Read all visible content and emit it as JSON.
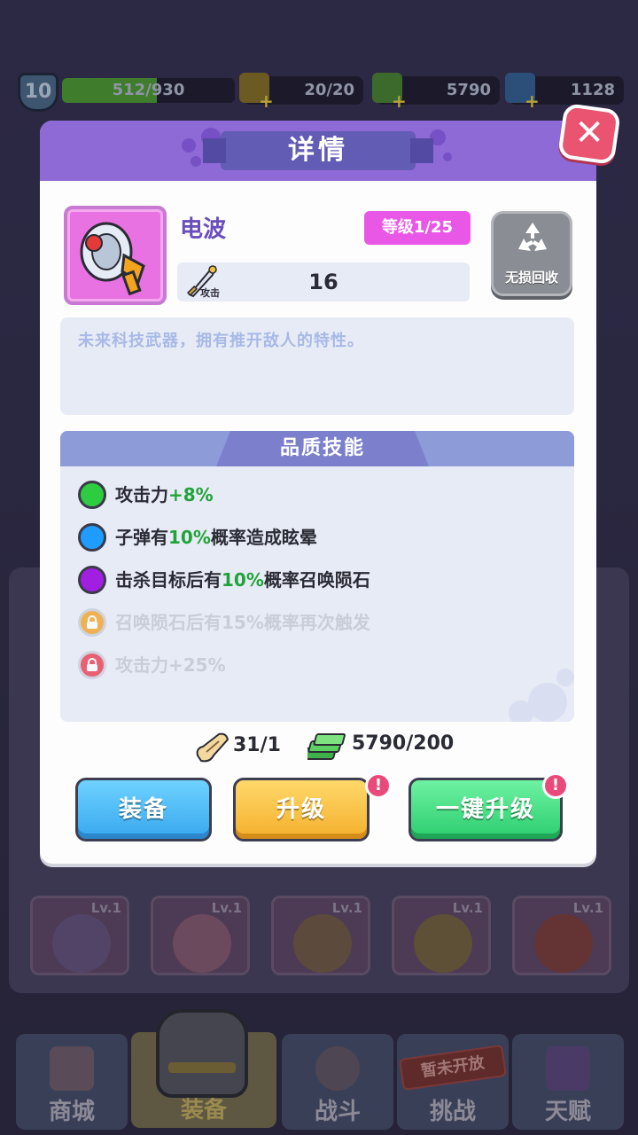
{
  "background": {
    "player_level": "10",
    "xp": {
      "text": "512/930",
      "fraction": 0.55
    },
    "energy": "20/20",
    "cash": "5790",
    "gems": "1128",
    "inventory_items": [
      {
        "level": "Lv.1",
        "name": "pocket-watch"
      },
      {
        "level": "Lv.1",
        "name": "shell-necklace"
      },
      {
        "level": "Lv.1",
        "name": "moon-necklace"
      },
      {
        "level": "Lv.1",
        "name": "straw-hat"
      },
      {
        "level": "Lv.1",
        "name": "red-cap"
      }
    ],
    "nav": {
      "shop": "商城",
      "equip": "装备",
      "battle": "战斗",
      "challenge": "挑战",
      "talent": "天赋",
      "stamp": "暂未开放"
    }
  },
  "dialog": {
    "title": "详情",
    "close_icon": "close-icon",
    "item": {
      "name": "电波",
      "level_badge": "等级1/25",
      "stat_icon_label": "攻击",
      "stat_value": "16",
      "recycle_label": "无损回收",
      "description": "未来科技武器，拥有推开敌人的特性。"
    },
    "skills": {
      "title": "品质技能",
      "items": [
        {
          "pre": "攻击力",
          "highlight": "+8%",
          "post": "",
          "color": "#2ecc40",
          "locked": false
        },
        {
          "pre": "子弹有",
          "highlight": "10%",
          "post": "概率造成眩晕",
          "color": "#1e9cff",
          "locked": false
        },
        {
          "pre": "击杀目标后有",
          "highlight": "10%",
          "post": "概率召唤陨石",
          "color": "#a21ee0",
          "locked": false
        },
        {
          "text": "召唤陨石后有15%概率再次触发",
          "color": "#f0a020",
          "locked": true
        },
        {
          "text": "攻击力+25%",
          "color": "#e8334a",
          "locked": true
        }
      ]
    },
    "cost": {
      "scroll": "31/1",
      "money": "5790/200"
    },
    "buttons": {
      "equip": "装备",
      "upgrade": "升级",
      "one_click_upgrade": "一键升级",
      "alert_mark": "!"
    }
  }
}
